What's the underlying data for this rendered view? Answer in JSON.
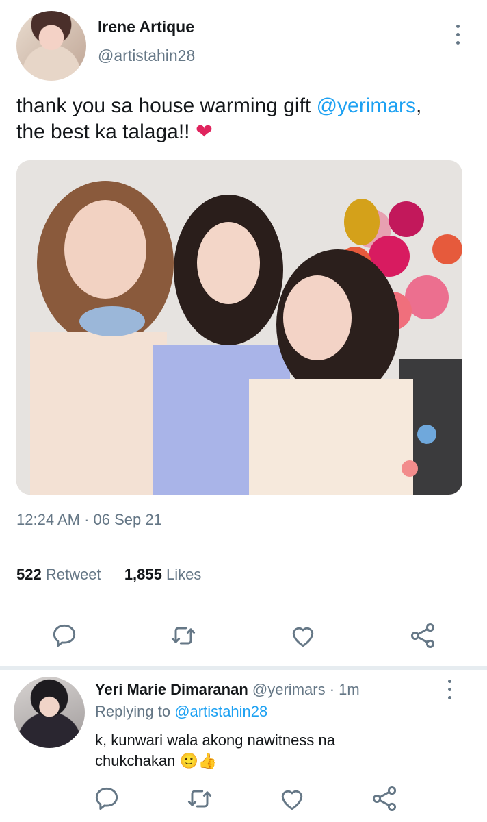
{
  "tweet": {
    "author_name": "Irene Artique",
    "author_handle": "@artistahin28",
    "text_part1": "thank you sa house warming gift ",
    "mention": "@yerimars",
    "text_part2": ",",
    "text_line2": "the best ka talaga!! ",
    "heart": "❤",
    "timestamp": "12:24 AM · 06 Sep 21",
    "retweet_count": "522",
    "retweet_label": "Retweet",
    "likes_count": "1,855",
    "likes_label": "Likes"
  },
  "actions": [
    "reply-icon",
    "retweet-icon",
    "like-icon",
    "share-icon"
  ],
  "reply": {
    "author_name": "Yeri Marie Dimaranan",
    "author_handle": "@yerimars",
    "time": "1m",
    "replying_label": "Replying to ",
    "replying_handle": "@artistahin28",
    "text_line1": "k, kunwari wala akong nawitness na",
    "text_line2": "chukchakan ",
    "emojis": "🙂👍"
  },
  "colors": {
    "accent": "#1da1f2",
    "muted": "#657786",
    "heart": "#e0245e"
  }
}
